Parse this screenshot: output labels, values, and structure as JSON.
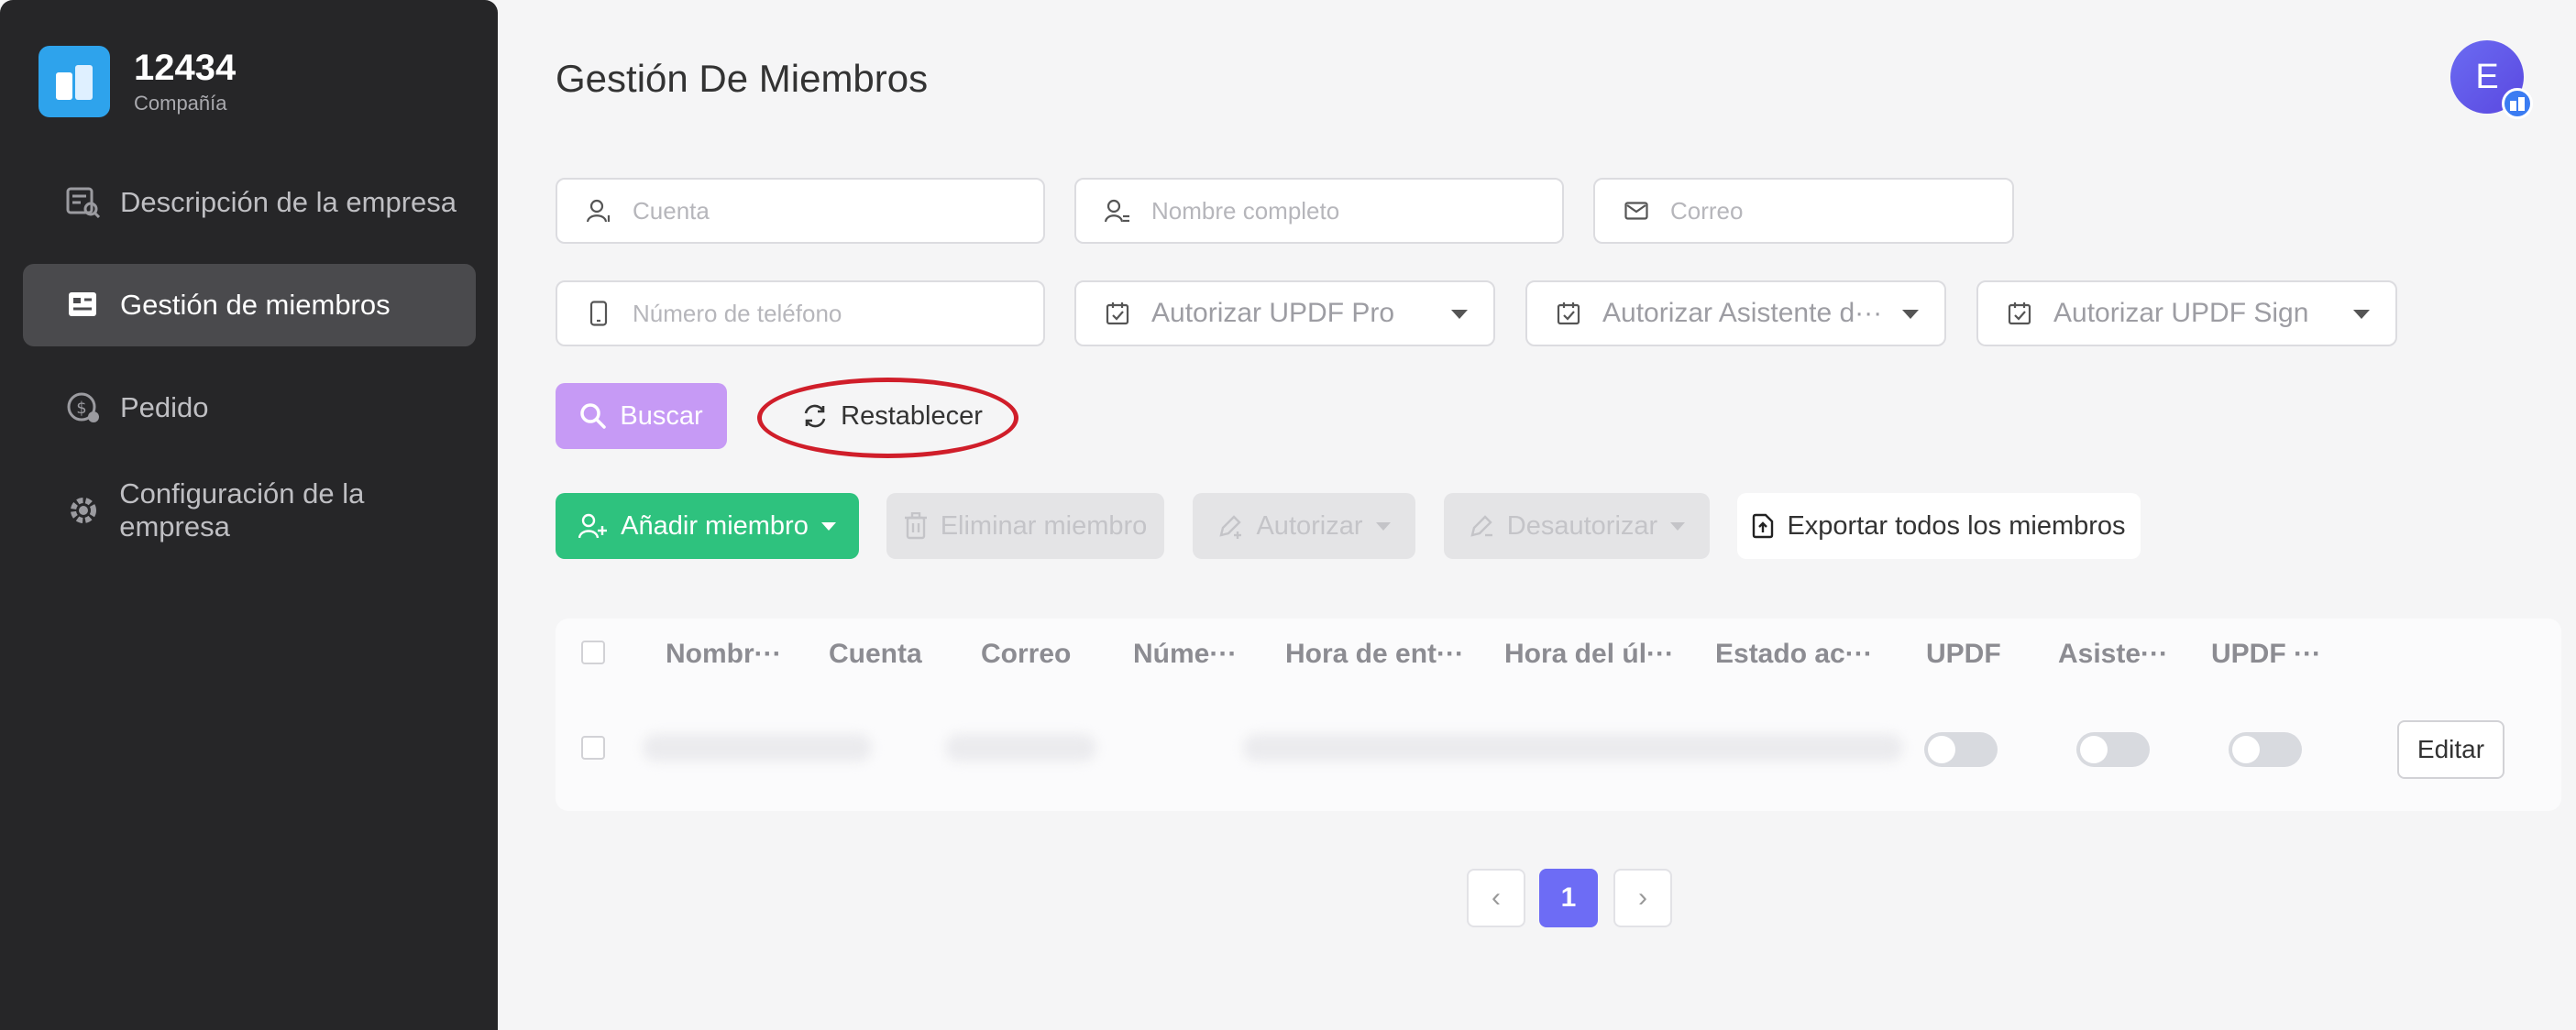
{
  "brand": {
    "name": "12434",
    "subtitle": "Compañía"
  },
  "sidebar": {
    "items": [
      {
        "label": "Descripción de la empresa",
        "icon": "company-description-icon"
      },
      {
        "label": "Gestión de miembros",
        "icon": "member-management-icon",
        "active": true
      },
      {
        "label": "Pedido",
        "icon": "order-icon"
      },
      {
        "label": "Configuración de la empresa",
        "icon": "gear-icon"
      }
    ]
  },
  "header": {
    "title": "Gestión De Miembros",
    "avatar_letter": "E"
  },
  "filters": {
    "account_placeholder": "Cuenta",
    "fullname_placeholder": "Nombre completo",
    "email_placeholder": "Correo",
    "phone_placeholder": "Número de teléfono",
    "authorize_pro": "Autorizar UPDF Pro",
    "authorize_assistant": "Autorizar Asistente d···",
    "authorize_sign": "Autorizar UPDF Sign"
  },
  "actions": {
    "search": "Buscar",
    "reset": "Restablecer",
    "add_member": "Añadir miembro",
    "delete_member": "Eliminar miembro",
    "authorize": "Autorizar",
    "deauthorize": "Desautorizar",
    "export_all": "Exportar todos los miembros"
  },
  "table": {
    "columns": [
      "Nombr···",
      "Cuenta",
      "Correo",
      "Núme···",
      "Hora de ent···",
      "Hora del úl···",
      "Estado ac···",
      "UPDF",
      "Asiste···",
      "UPDF ···"
    ],
    "row_edit_label": "Editar"
  },
  "pagination": {
    "current_page": "1",
    "prev": "‹",
    "next": "›"
  },
  "colors": {
    "accent": "#6d6cf5",
    "search": "#c69af5",
    "add": "#2ec27e",
    "highlight_ring": "#d01e2a"
  }
}
